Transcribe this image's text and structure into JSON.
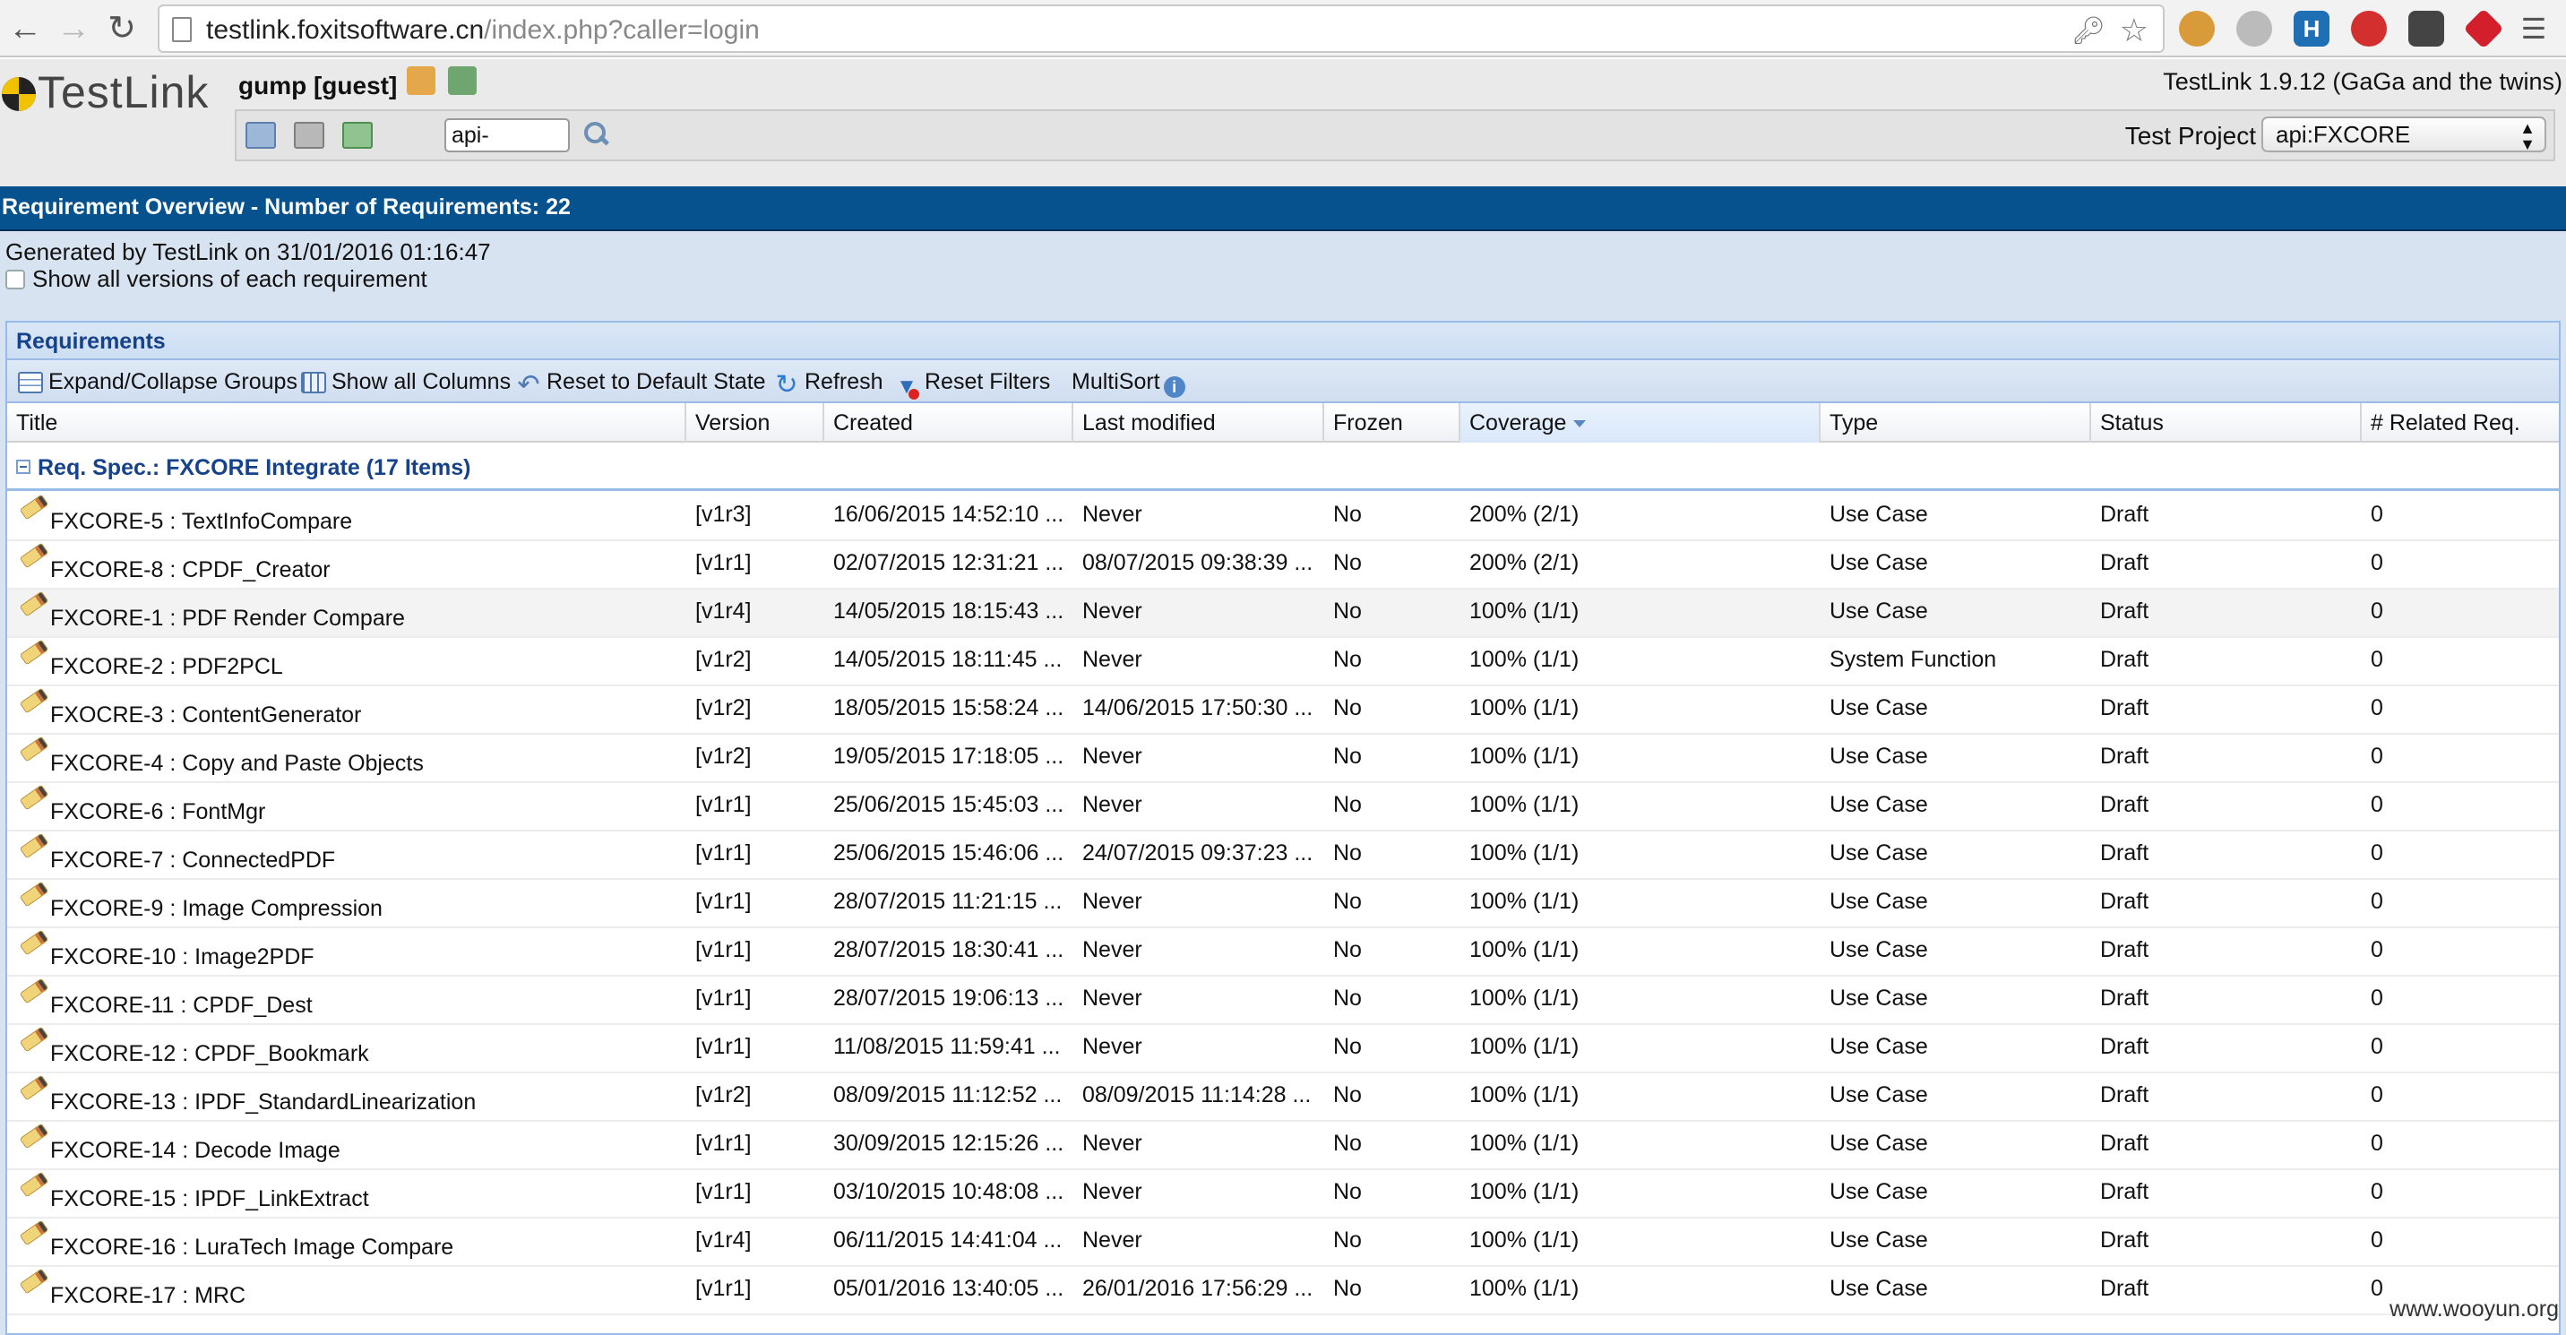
{
  "browser": {
    "url_host": "testlink.foxitsoftware.cn",
    "url_path": "/index.php?caller=login"
  },
  "app": {
    "logo_text": "TestLink",
    "user": "gump [guest]",
    "version": "TestLink 1.9.12 (GaGa and the twins)",
    "search_value": "api-",
    "project_label": "Test Project",
    "project_value": "api:FXCORE"
  },
  "page": {
    "title": "Requirement Overview - Number of Requirements: 22",
    "generated": "Generated by TestLink on 31/01/2016 01:16:47",
    "show_versions_label": "Show all versions of each requirement"
  },
  "panel": {
    "title": "Requirements",
    "toolbar": {
      "expand": "Expand/Collapse Groups",
      "show_columns": "Show all Columns",
      "reset": "Reset to Default State",
      "refresh": "Refresh",
      "reset_filters": "Reset Filters",
      "multisort": "MultiSort"
    },
    "columns": {
      "title": "Title",
      "version": "Version",
      "created": "Created",
      "modified": "Last modified",
      "frozen": "Frozen",
      "coverage": "Coverage",
      "type": "Type",
      "status": "Status",
      "related": "# Related Req."
    },
    "group_label": "Req. Spec.: FXCORE Integrate (17 Items)",
    "rows": [
      {
        "title": "FXCORE-5 : TextInfoCompare",
        "version": "[v1r3]",
        "created": "16/06/2015 14:52:10 ...",
        "modified": "Never",
        "frozen": "No",
        "coverage": "200% (2/1)",
        "type": "Use Case",
        "status": "Draft",
        "related": "0"
      },
      {
        "title": "FXCORE-8 : CPDF_Creator",
        "version": "[v1r1]",
        "created": "02/07/2015 12:31:21 ...",
        "modified": "08/07/2015 09:38:39 ...",
        "frozen": "No",
        "coverage": "200% (2/1)",
        "type": "Use Case",
        "status": "Draft",
        "related": "0"
      },
      {
        "title": "FXCORE-1 : PDF Render Compare",
        "version": "[v1r4]",
        "created": "14/05/2015 18:15:43 ...",
        "modified": "Never",
        "frozen": "No",
        "coverage": "100% (1/1)",
        "type": "Use Case",
        "status": "Draft",
        "related": "0"
      },
      {
        "title": "FXCORE-2 : PDF2PCL",
        "version": "[v1r2]",
        "created": "14/05/2015 18:11:45 ...",
        "modified": "Never",
        "frozen": "No",
        "coverage": "100% (1/1)",
        "type": "System Function",
        "status": "Draft",
        "related": "0"
      },
      {
        "title": "FXOCRE-3 : ContentGenerator",
        "version": "[v1r2]",
        "created": "18/05/2015 15:58:24 ...",
        "modified": "14/06/2015 17:50:30 ...",
        "frozen": "No",
        "coverage": "100% (1/1)",
        "type": "Use Case",
        "status": "Draft",
        "related": "0"
      },
      {
        "title": "FXCORE-4 : Copy and Paste Objects",
        "version": "[v1r2]",
        "created": "19/05/2015 17:18:05 ...",
        "modified": "Never",
        "frozen": "No",
        "coverage": "100% (1/1)",
        "type": "Use Case",
        "status": "Draft",
        "related": "0"
      },
      {
        "title": "FXCORE-6 : FontMgr",
        "version": "[v1r1]",
        "created": "25/06/2015 15:45:03 ...",
        "modified": "Never",
        "frozen": "No",
        "coverage": "100% (1/1)",
        "type": "Use Case",
        "status": "Draft",
        "related": "0"
      },
      {
        "title": "FXCORE-7 : ConnectedPDF",
        "version": "[v1r1]",
        "created": "25/06/2015 15:46:06 ...",
        "modified": "24/07/2015 09:37:23 ...",
        "frozen": "No",
        "coverage": "100% (1/1)",
        "type": "Use Case",
        "status": "Draft",
        "related": "0"
      },
      {
        "title": "FXCORE-9 : Image Compression",
        "version": "[v1r1]",
        "created": "28/07/2015 11:21:15 ...",
        "modified": "Never",
        "frozen": "No",
        "coverage": "100% (1/1)",
        "type": "Use Case",
        "status": "Draft",
        "related": "0"
      },
      {
        "title": "FXCORE-10 : Image2PDF",
        "version": "[v1r1]",
        "created": "28/07/2015 18:30:41 ...",
        "modified": "Never",
        "frozen": "No",
        "coverage": "100% (1/1)",
        "type": "Use Case",
        "status": "Draft",
        "related": "0"
      },
      {
        "title": "FXCORE-11 : CPDF_Dest",
        "version": "[v1r1]",
        "created": "28/07/2015 19:06:13 ...",
        "modified": "Never",
        "frozen": "No",
        "coverage": "100% (1/1)",
        "type": "Use Case",
        "status": "Draft",
        "related": "0"
      },
      {
        "title": "FXCORE-12 : CPDF_Bookmark",
        "version": "[v1r1]",
        "created": "11/08/2015 11:59:41 ...",
        "modified": "Never",
        "frozen": "No",
        "coverage": "100% (1/1)",
        "type": "Use Case",
        "status": "Draft",
        "related": "0"
      },
      {
        "title": "FXCORE-13 : IPDF_StandardLinearization",
        "version": "[v1r2]",
        "created": "08/09/2015 11:12:52 ...",
        "modified": "08/09/2015 11:14:28 ...",
        "frozen": "No",
        "coverage": "100% (1/1)",
        "type": "Use Case",
        "status": "Draft",
        "related": "0"
      },
      {
        "title": "FXCORE-14 : Decode Image",
        "version": "[v1r1]",
        "created": "30/09/2015 12:15:26 ...",
        "modified": "Never",
        "frozen": "No",
        "coverage": "100% (1/1)",
        "type": "Use Case",
        "status": "Draft",
        "related": "0"
      },
      {
        "title": "FXCORE-15 : IPDF_LinkExtract",
        "version": "[v1r1]",
        "created": "03/10/2015 10:48:08 ...",
        "modified": "Never",
        "frozen": "No",
        "coverage": "100% (1/1)",
        "type": "Use Case",
        "status": "Draft",
        "related": "0"
      },
      {
        "title": "FXCORE-16 : LuraTech Image Compare",
        "version": "[v1r4]",
        "created": "06/11/2015 14:41:04 ...",
        "modified": "Never",
        "frozen": "No",
        "coverage": "100% (1/1)",
        "type": "Use Case",
        "status": "Draft",
        "related": "0"
      },
      {
        "title": "FXCORE-17 : MRC",
        "version": "[v1r1]",
        "created": "05/01/2016 13:40:05 ...",
        "modified": "26/01/2016 17:56:29 ...",
        "frozen": "No",
        "coverage": "100% (1/1)",
        "type": "Use Case",
        "status": "Draft",
        "related": "0"
      }
    ]
  },
  "watermark": "www.wooyun.org"
}
